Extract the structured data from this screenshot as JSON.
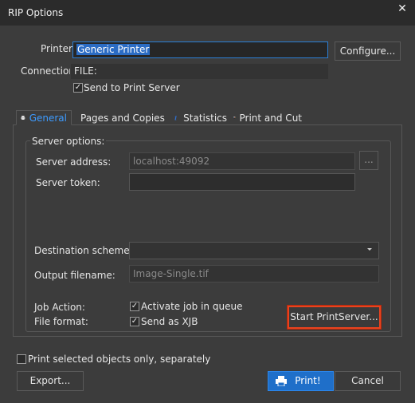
{
  "window": {
    "title": "RIP Options",
    "close_glyph": "✕"
  },
  "printer": {
    "label": "Printer:",
    "value": "Generic Printer",
    "configure_label": "Configure..."
  },
  "connection": {
    "label": "Connection:",
    "value": "FILE:",
    "send_to_server_label": "Send to Print Server",
    "send_to_server_checked": true
  },
  "tabs": [
    {
      "label": "General",
      "icon": "printer-icon",
      "active": true
    },
    {
      "label": "Pages and Copies",
      "icon": "pages-icon",
      "active": false
    },
    {
      "label": "Statistics",
      "icon": "info-icon",
      "active": false
    },
    {
      "label": "Print and Cut",
      "icon": "print-cut-icon",
      "active": false
    }
  ],
  "server_options": {
    "group_title": "Server options:",
    "server_address_label": "Server address:",
    "server_address_value": "localhost:49092",
    "browse_label": "...",
    "server_token_label": "Server token:",
    "server_token_value": "",
    "destination_scheme_label": "Destination scheme:",
    "destination_scheme_value": "",
    "output_filename_label": "Output filename:",
    "output_filename_value": "Image-Single.tif",
    "job_action_label": "Job Action:",
    "activate_job_label": "Activate job in queue",
    "activate_job_checked": true,
    "file_format_label": "File format:",
    "send_as_xjb_label": "Send as XJB",
    "send_as_xjb_checked": true,
    "start_server_label": "Start PrintServer..."
  },
  "footer": {
    "print_selected_label": "Print selected objects only, separately",
    "print_selected_checked": false,
    "export_label": "Export...",
    "print_label": "Print!",
    "cancel_label": "Cancel"
  },
  "colors": {
    "accent": "#1f6fc9",
    "tab_active_text": "#3d9bff",
    "highlight_border": "#e8431f"
  }
}
